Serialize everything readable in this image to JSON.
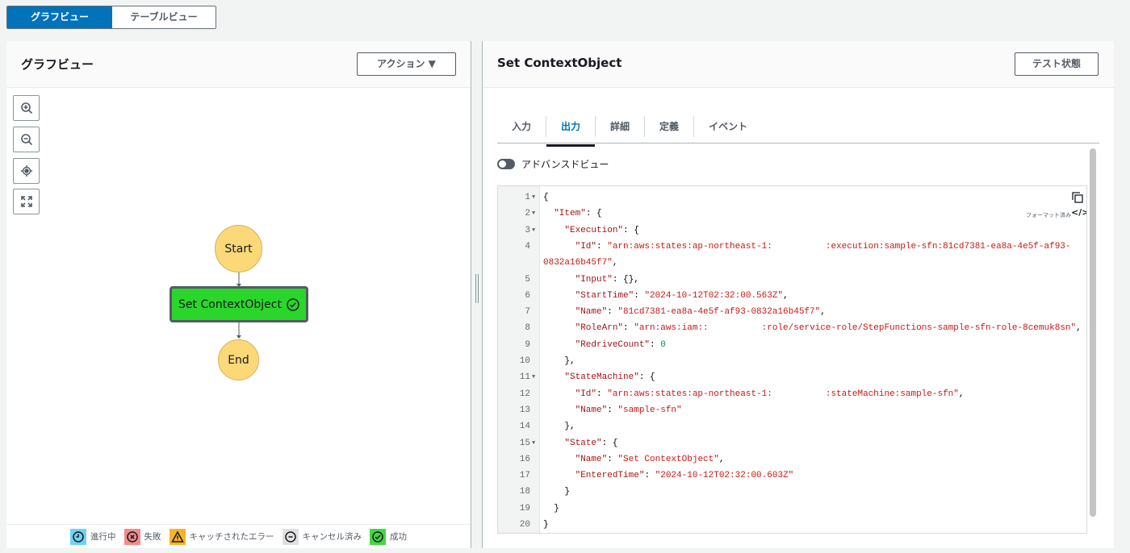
{
  "view_toggle": {
    "graph": "グラフビュー",
    "table": "テーブルビュー"
  },
  "left": {
    "title": "グラフビュー",
    "actions": "アクション ▼",
    "tools": [
      "zoom-in-icon",
      "zoom-out-icon",
      "center-icon",
      "fit-icon"
    ],
    "nodes": {
      "start": "Start",
      "task": "Set ContextObject",
      "end": "End"
    },
    "legend": [
      {
        "label": "進行中",
        "color": "#6fd3f2",
        "icon": "clock-icon"
      },
      {
        "label": "失敗",
        "color": "#f28b8b",
        "icon": "x-circle-icon"
      },
      {
        "label": "キャッチされたエラー",
        "color": "#f7b32b",
        "icon": "warning-icon"
      },
      {
        "label": "キャンセル済み",
        "color": "#e0e0e0",
        "icon": "minus-circle-icon"
      },
      {
        "label": "成功",
        "color": "#45d642",
        "icon": "check-circle-icon"
      }
    ]
  },
  "right": {
    "title": "Set ContextObject",
    "test_state": "テスト状態",
    "tabs": [
      "入力",
      "出力",
      "詳細",
      "定義",
      "イベント"
    ],
    "active_tab": 1,
    "advanced_view": "アドバンスドビュー",
    "formatted": "フォーマット済み",
    "code": [
      {
        "n": "1",
        "fold": true,
        "segs": [
          [
            "p",
            "{"
          ]
        ]
      },
      {
        "n": "2",
        "fold": true,
        "segs": [
          [
            "p",
            "  "
          ],
          [
            "k",
            "\"Item\""
          ],
          [
            "p",
            ": {"
          ]
        ]
      },
      {
        "n": "3",
        "fold": true,
        "segs": [
          [
            "p",
            "    "
          ],
          [
            "k",
            "\"Execution\""
          ],
          [
            "p",
            ": {"
          ]
        ]
      },
      {
        "n": "4",
        "segs": [
          [
            "p",
            "      "
          ],
          [
            "k",
            "\"Id\""
          ],
          [
            "p",
            ": "
          ],
          [
            "s",
            "\"arn:aws:states:ap-northeast-1:"
          ],
          [
            "r",
            ""
          ],
          [
            "s",
            ":execution:sample-sfn:81cd7381-ea8a-4e5f-af93-"
          ]
        ]
      },
      {
        "n": "",
        "segs": [
          [
            "s",
            "0832a16b45f7\""
          ],
          [
            "p",
            ","
          ]
        ]
      },
      {
        "n": "5",
        "segs": [
          [
            "p",
            "      "
          ],
          [
            "k",
            "\"Input\""
          ],
          [
            "p",
            ": {},"
          ]
        ]
      },
      {
        "n": "6",
        "segs": [
          [
            "p",
            "      "
          ],
          [
            "k",
            "\"StartTime\""
          ],
          [
            "p",
            ": "
          ],
          [
            "s",
            "\"2024-10-12T02:32:00.563Z\""
          ],
          [
            "p",
            ","
          ]
        ]
      },
      {
        "n": "7",
        "segs": [
          [
            "p",
            "      "
          ],
          [
            "k",
            "\"Name\""
          ],
          [
            "p",
            ": "
          ],
          [
            "s",
            "\"81cd7381-ea8a-4e5f-af93-0832a16b45f7\""
          ],
          [
            "p",
            ","
          ]
        ]
      },
      {
        "n": "8",
        "segs": [
          [
            "p",
            "      "
          ],
          [
            "k",
            "\"RoleArn\""
          ],
          [
            "p",
            ": "
          ],
          [
            "s",
            "\"arn:aws:iam::"
          ],
          [
            "r",
            ""
          ],
          [
            "s",
            ":role/service-role/StepFunctions-sample-sfn-role-8cemuk8sn\""
          ],
          [
            "p",
            ","
          ]
        ]
      },
      {
        "n": "9",
        "segs": [
          [
            "p",
            "      "
          ],
          [
            "k",
            "\"RedriveCount\""
          ],
          [
            "p",
            ": "
          ],
          [
            "n",
            "0"
          ]
        ]
      },
      {
        "n": "10",
        "segs": [
          [
            "p",
            "    },"
          ]
        ]
      },
      {
        "n": "11",
        "fold": true,
        "segs": [
          [
            "p",
            "    "
          ],
          [
            "k",
            "\"StateMachine\""
          ],
          [
            "p",
            ": {"
          ]
        ]
      },
      {
        "n": "12",
        "segs": [
          [
            "p",
            "      "
          ],
          [
            "k",
            "\"Id\""
          ],
          [
            "p",
            ": "
          ],
          [
            "s",
            "\"arn:aws:states:ap-northeast-1:"
          ],
          [
            "r",
            ""
          ],
          [
            "s",
            ":stateMachine:sample-sfn\""
          ],
          [
            "p",
            ","
          ]
        ]
      },
      {
        "n": "13",
        "segs": [
          [
            "p",
            "      "
          ],
          [
            "k",
            "\"Name\""
          ],
          [
            "p",
            ": "
          ],
          [
            "s",
            "\"sample-sfn\""
          ]
        ]
      },
      {
        "n": "14",
        "segs": [
          [
            "p",
            "    },"
          ]
        ]
      },
      {
        "n": "15",
        "fold": true,
        "segs": [
          [
            "p",
            "    "
          ],
          [
            "k",
            "\"State\""
          ],
          [
            "p",
            ": {"
          ]
        ]
      },
      {
        "n": "16",
        "segs": [
          [
            "p",
            "      "
          ],
          [
            "k",
            "\"Name\""
          ],
          [
            "p",
            ": "
          ],
          [
            "s",
            "\"Set ContextObject\""
          ],
          [
            "p",
            ","
          ]
        ]
      },
      {
        "n": "17",
        "segs": [
          [
            "p",
            "      "
          ],
          [
            "k",
            "\"EnteredTime\""
          ],
          [
            "p",
            ": "
          ],
          [
            "s",
            "\"2024-10-12T02:32:00.603Z\""
          ]
        ]
      },
      {
        "n": "18",
        "segs": [
          [
            "p",
            "    }"
          ]
        ]
      },
      {
        "n": "19",
        "segs": [
          [
            "p",
            "  }"
          ]
        ]
      },
      {
        "n": "20",
        "segs": [
          [
            "p",
            "}"
          ]
        ]
      }
    ]
  }
}
